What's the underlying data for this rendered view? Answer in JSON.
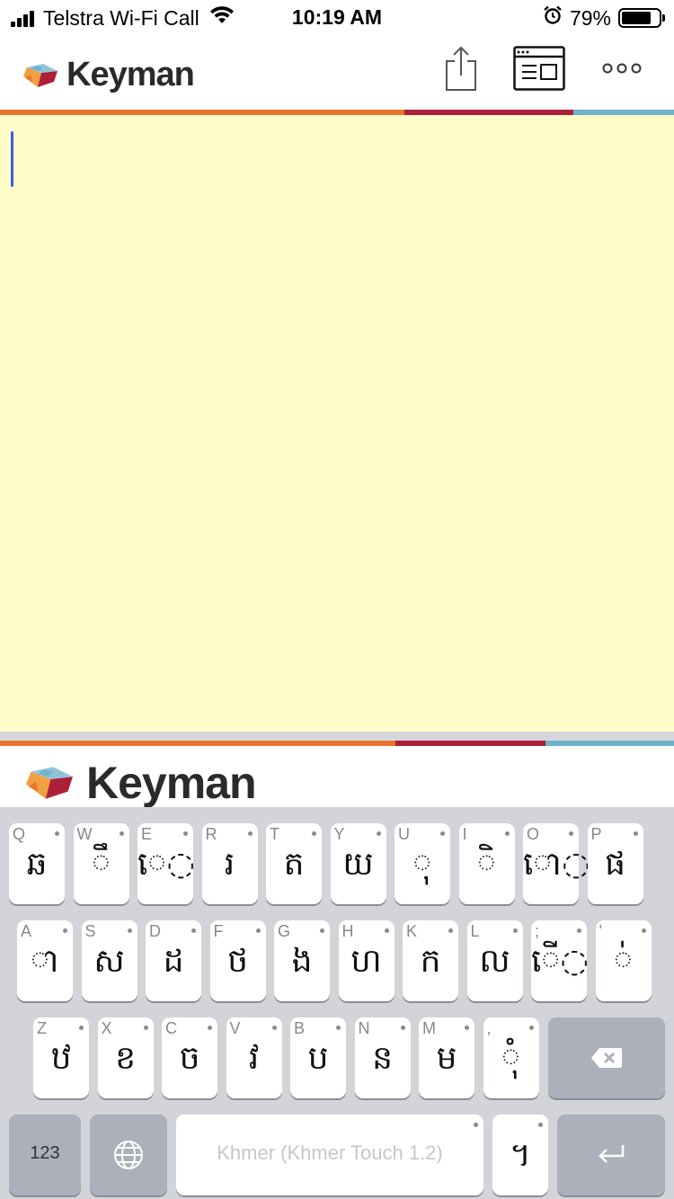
{
  "status_bar": {
    "carrier": "Telstra Wi-Fi Call",
    "time": "10:19 AM",
    "battery": "79%",
    "battery_level": 0.79
  },
  "header": {
    "logo_text": "Keyman",
    "share_icon": "share-icon",
    "browser_icon": "browser-window-icon",
    "more_icon": "more-options-icon"
  },
  "brand_colors": {
    "orange": "#e8752d",
    "red": "#ad2037",
    "blue": "#6eb3cb",
    "text_bg": "#fefdca"
  },
  "keyboard": {
    "banner_text": "Keyman",
    "rows": [
      [
        {
          "hint": "Q",
          "glyph": "ឆ"
        },
        {
          "hint": "W",
          "glyph": "◌ឹ"
        },
        {
          "hint": "E",
          "glyph": "េ◌"
        },
        {
          "hint": "R",
          "glyph": "រ"
        },
        {
          "hint": "T",
          "glyph": "ត"
        },
        {
          "hint": "Y",
          "glyph": "យ"
        },
        {
          "hint": "U",
          "glyph": "◌ុ"
        },
        {
          "hint": "I",
          "glyph": "◌ិ"
        },
        {
          "hint": "O",
          "glyph": "ោ◌"
        },
        {
          "hint": "P",
          "glyph": "ផ"
        }
      ],
      [
        {
          "hint": "A",
          "glyph": "◌ា"
        },
        {
          "hint": "S",
          "glyph": "ស"
        },
        {
          "hint": "D",
          "glyph": "ដ"
        },
        {
          "hint": "F",
          "glyph": "ថ"
        },
        {
          "hint": "G",
          "glyph": "ង"
        },
        {
          "hint": "H",
          "glyph": "ហ"
        },
        {
          "hint": "K",
          "glyph": "ក"
        },
        {
          "hint": "L",
          "glyph": "ល"
        },
        {
          "hint": ";",
          "glyph": "ើ◌"
        },
        {
          "hint": "'",
          "glyph": "◌់"
        }
      ],
      [
        {
          "hint": "Z",
          "glyph": "ឋ"
        },
        {
          "hint": "X",
          "glyph": "ខ"
        },
        {
          "hint": "C",
          "glyph": "ច"
        },
        {
          "hint": "V",
          "glyph": "វ"
        },
        {
          "hint": "B",
          "glyph": "ប"
        },
        {
          "hint": "N",
          "glyph": "ន"
        },
        {
          "hint": "M",
          "glyph": "ម"
        },
        {
          "hint": ",",
          "glyph": "◌ុំ"
        }
      ]
    ],
    "backspace_icon": "backspace-icon",
    "numbers_label": "123",
    "globe_icon": "globe-icon",
    "space_label": "Khmer (Khmer Touch 1.2)",
    "period_glyph": "។",
    "enter_icon": "enter-icon"
  }
}
